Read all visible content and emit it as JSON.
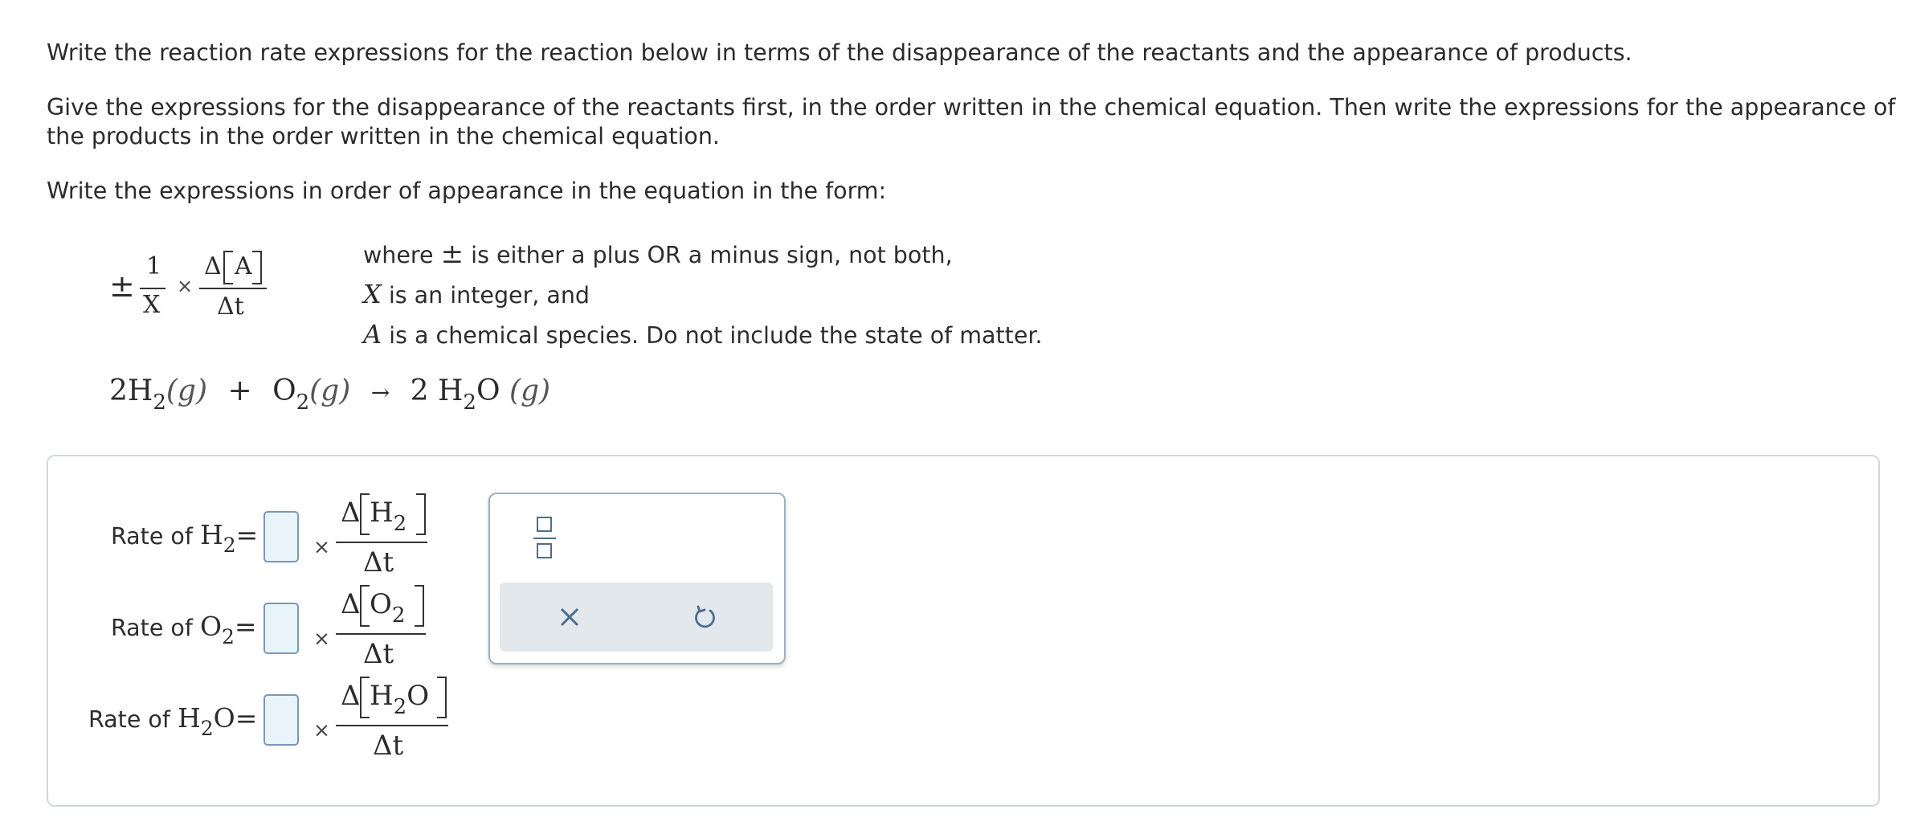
{
  "instructions": {
    "p1": "Write the reaction rate expressions for the reaction below in terms of the disappearance of the reactants and the appearance of products.",
    "p2_line1": "Give the expressions for the disappearance of the reactants first, in the order written in the chemical equation. Then write the expressions for the appearance of",
    "p2_line2": "the products in the order written in the chemical equation.",
    "p3": "Write the expressions in order of appearance in the equation in the form:"
  },
  "general_form": {
    "sign": "±",
    "numerator": "1",
    "denominator": "X",
    "times": "×",
    "delta_A": "Δ",
    "species": "A",
    "delta_t": "Δt"
  },
  "notes": {
    "n1_prefix": "where",
    "n1_symbol": "±",
    "n1_suffix": "is either a plus OR a minus sign, not both,",
    "n2_var": "X",
    "n2_text": "is an integer, and",
    "n3_var": "A",
    "n3_text": "is a chemical species. Do not include the state of matter."
  },
  "equation": {
    "coef1": "2",
    "sp1": "H",
    "sp1_sub": "2",
    "state1": "(g)",
    "plus": "+",
    "sp2": "O",
    "sp2_sub": "2",
    "state2": "(g)",
    "arrow": "→",
    "coef3": "2",
    "sp3a": "H",
    "sp3_sub": "2",
    "sp3b": "O",
    "state3": "(g)"
  },
  "rows": [
    {
      "label": "Rate of",
      "chem": "H",
      "chem_sub": "2",
      "chem_tail": "",
      "eq": "=",
      "times": "×",
      "delta": "Δ",
      "num_chem": "H",
      "num_sub": "2",
      "num_tail": "",
      "den": "Δt"
    },
    {
      "label": "Rate of",
      "chem": "O",
      "chem_sub": "2",
      "chem_tail": "",
      "eq": "=",
      "times": "×",
      "delta": "Δ",
      "num_chem": "O",
      "num_sub": "2",
      "num_tail": "",
      "den": "Δt"
    },
    {
      "label": "Rate of",
      "chem": "H",
      "chem_sub": "2",
      "chem_tail": "O",
      "eq": "=",
      "times": "×",
      "delta": "Δ",
      "num_chem": "H",
      "num_sub": "2",
      "num_tail": "O",
      "den": "Δt"
    }
  ],
  "toolbox": {
    "fraction_icon": "fraction-template-icon",
    "clear_icon": "close-icon",
    "undo_icon": "undo-icon",
    "accent": "#4b6e90"
  }
}
